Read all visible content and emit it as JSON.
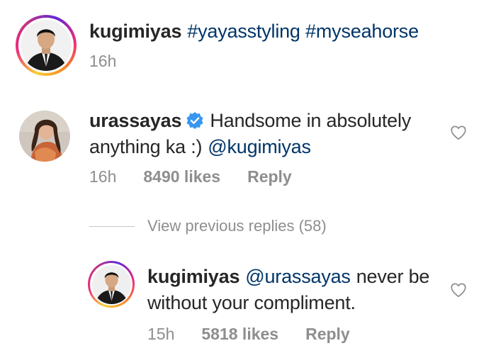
{
  "caption": {
    "username": "kugimiyas",
    "text": "#yayasstyling #myseahorse",
    "time": "16h"
  },
  "comment": {
    "username": "urassayas",
    "text_part1": "Handsome in absolutely",
    "text_part2": "anything ka :)",
    "mention": "@kugimiyas",
    "time": "16h",
    "likes": "8490 likes",
    "reply_label": "Reply"
  },
  "view_previous": "View previous replies (58)",
  "reply": {
    "username": "kugimiyas",
    "mention": "@urassayas",
    "text_part1": "never be",
    "text_part2": "without your compliment.",
    "time": "15h",
    "likes": "5818 likes",
    "reply_label": "Reply"
  },
  "colors": {
    "link": "#003569",
    "muted": "#8e8e8e",
    "verified": "#3897f0"
  }
}
